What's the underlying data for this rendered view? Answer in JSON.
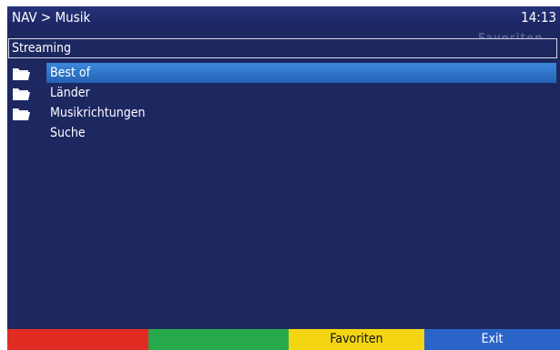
{
  "header": {
    "title": "NAV > Musik",
    "time": "14:13"
  },
  "background_text": "Favoriten",
  "section": {
    "title": "Streaming"
  },
  "items": [
    {
      "label": "Best of",
      "icon": "folder-icon",
      "selected": true
    },
    {
      "label": "Länder",
      "icon": "folder-icon",
      "selected": false
    },
    {
      "label": "Musikrichtungen",
      "icon": "folder-icon",
      "selected": false
    },
    {
      "label": "Suche",
      "icon": "",
      "selected": false
    }
  ],
  "footer": {
    "red": "",
    "green": "",
    "yellow": "Favoriten",
    "blue": "Exit"
  },
  "colors": {
    "background": "#1d2760",
    "selection": "#2f74cc",
    "red": "#e02c23",
    "green": "#27a84a",
    "yellow": "#f4d512",
    "blue": "#2a64c8"
  }
}
